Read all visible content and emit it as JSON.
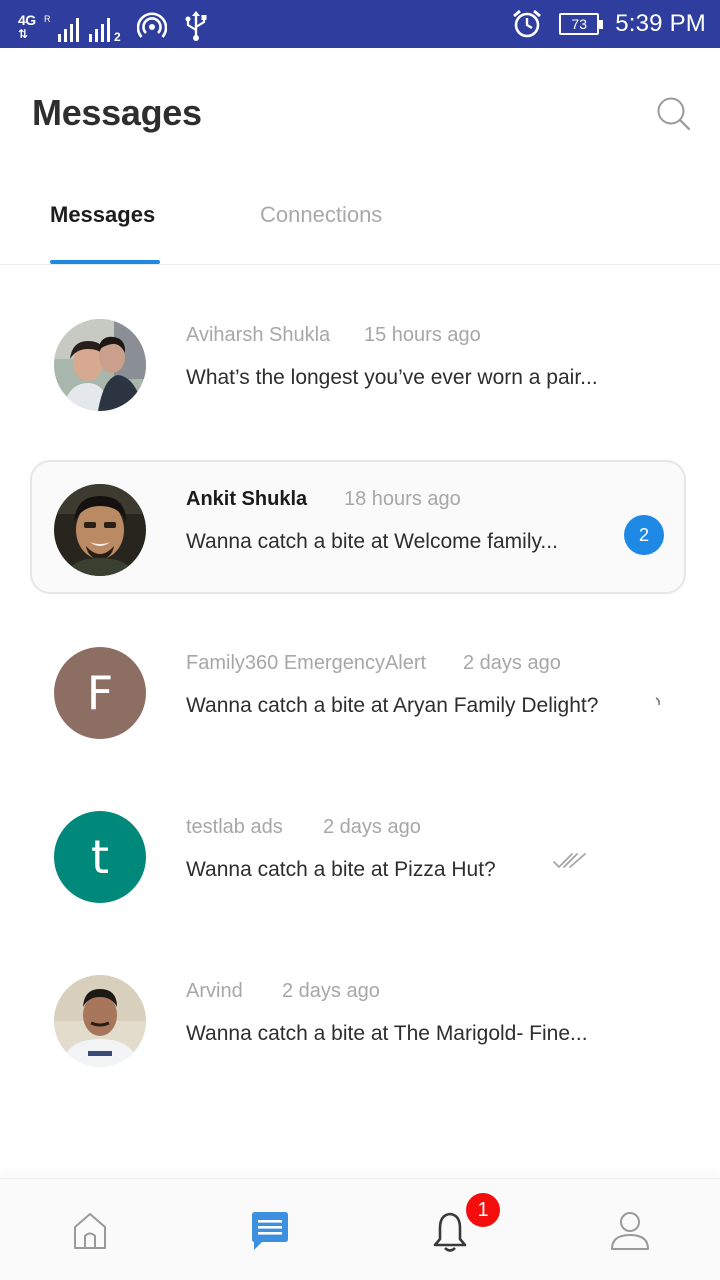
{
  "status_bar": {
    "network": "4G",
    "roaming": "R",
    "sim2_label": "2",
    "battery": "73",
    "time": "5:39 PM"
  },
  "header": {
    "title": "Messages"
  },
  "tabs": [
    {
      "label": "Messages",
      "active": true
    },
    {
      "label": "Connections",
      "active": false
    }
  ],
  "conversations": [
    {
      "name": "Aviharsh Shukla",
      "time": "15 hours ago",
      "preview": "What’s the longest you’ve ever worn a pair...",
      "unread_count": null,
      "avatar": "photo"
    },
    {
      "name": "Ankit Shukla",
      "time": "18 hours ago",
      "preview": "Wanna catch a bite at Welcome family...",
      "unread_count": "2",
      "avatar": "photo"
    },
    {
      "name": "Family360 EmergencyAlert",
      "time": "2 days ago",
      "preview": "Wanna catch a bite at Aryan Family Delight?",
      "unread_count": null,
      "avatar_letter": "F",
      "avatar_color": "#8d6e63"
    },
    {
      "name": "testlab ads",
      "time": "2 days ago",
      "preview": "Wanna catch a bite at Pizza Hut?",
      "unread_count": null,
      "avatar_letter": "t",
      "avatar_color": "#00897b",
      "status": "read"
    },
    {
      "name": "Arvind",
      "time": "2 days ago",
      "preview": "Wanna catch a bite at The Marigold- Fine...",
      "unread_count": null,
      "avatar": "photo"
    }
  ],
  "bottom_nav": {
    "items": [
      "home-icon",
      "messages-icon",
      "bell-icon",
      "profile-icon"
    ],
    "active": "messages-icon",
    "notification_count": "1"
  },
  "colors": {
    "status_bar": "#2f3e9e",
    "accent": "#1e88e5",
    "notification": "#f40d0d"
  }
}
